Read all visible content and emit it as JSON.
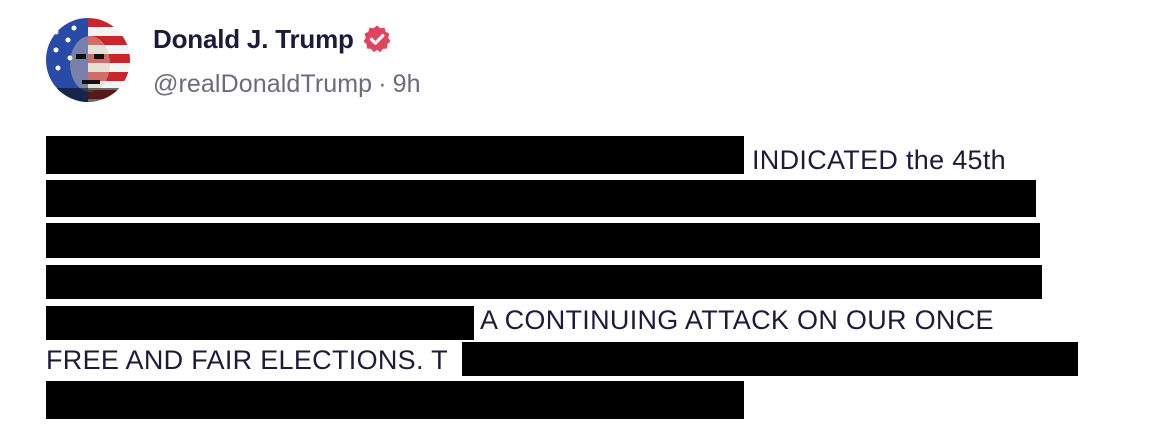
{
  "author": {
    "display_name": "Donald J. Trump",
    "handle": "@realDonaldTrump",
    "separator": "·",
    "time_ago": "9h",
    "verified_icon": "verified-badge-icon",
    "verified_color": "#e0445f",
    "avatar_icon": "avatar-flag-face"
  },
  "post": {
    "lines": [
      "INDICATED the 45th",
      "A CONTINUING ATTACK ON OUR ONCE",
      "FREE AND FAIR ELECTIONS. T"
    ],
    "redaction_color": "#000000"
  }
}
